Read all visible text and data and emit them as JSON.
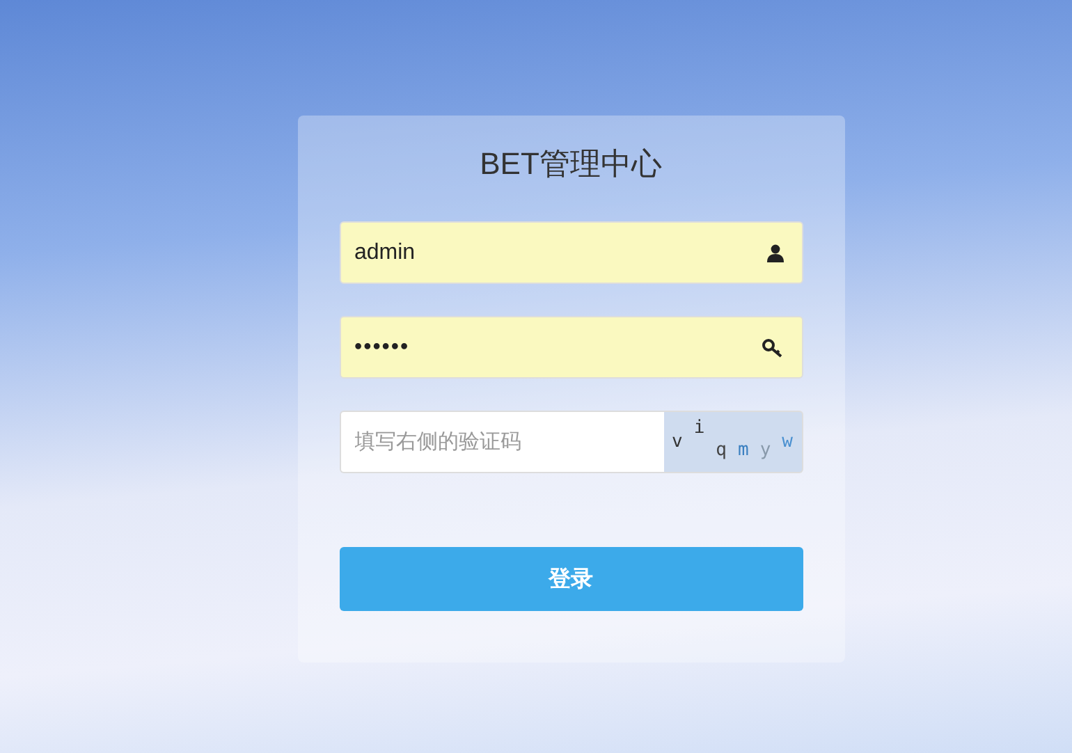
{
  "title": "BET管理中心",
  "username": {
    "value": "admin"
  },
  "password": {
    "value": "••••••"
  },
  "captcha": {
    "placeholder": "填写右侧的验证码",
    "chars": [
      {
        "char": "v",
        "color": "#333333"
      },
      {
        "char": "i",
        "color": "#333333"
      },
      {
        "char": "q",
        "color": "#444444"
      },
      {
        "char": "m",
        "color": "#3a7fc0"
      },
      {
        "char": "y",
        "color": "#8899aa"
      },
      {
        "char": "w",
        "color": "#4a90d0"
      }
    ]
  },
  "submit": {
    "label": "登录"
  }
}
